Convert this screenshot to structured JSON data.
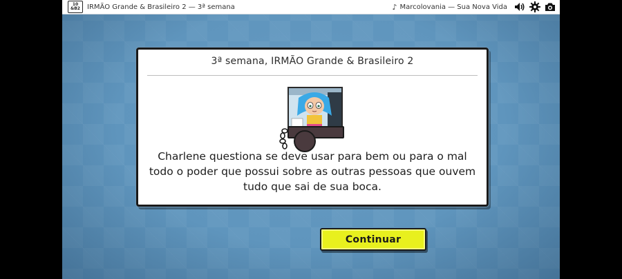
{
  "app": {
    "logo_top": "10",
    "logo_bottom": "&B2",
    "title": "IRMÃO Grande & Brasileiro 2 — 3ª semana"
  },
  "music": {
    "icon": "music-note-icon",
    "track": "Marcolovania — Sua Nova Vida"
  },
  "toolbar": {
    "icons": [
      "speaker-icon",
      "gear-icon",
      "camera-icon"
    ]
  },
  "dialog": {
    "title": "3ª semana, IRMÃO Grande & Brasileiro 2",
    "text": "Charlene questiona se deve usar para bem ou para o mal todo o poder que possui sobre as outras pessoas que ouvem tudo que sai de sua boca."
  },
  "actions": {
    "continue_label": "Continuar"
  },
  "colors": {
    "background": "#5f95bd",
    "button": "#e8f01e",
    "panel": "#ffffff"
  }
}
